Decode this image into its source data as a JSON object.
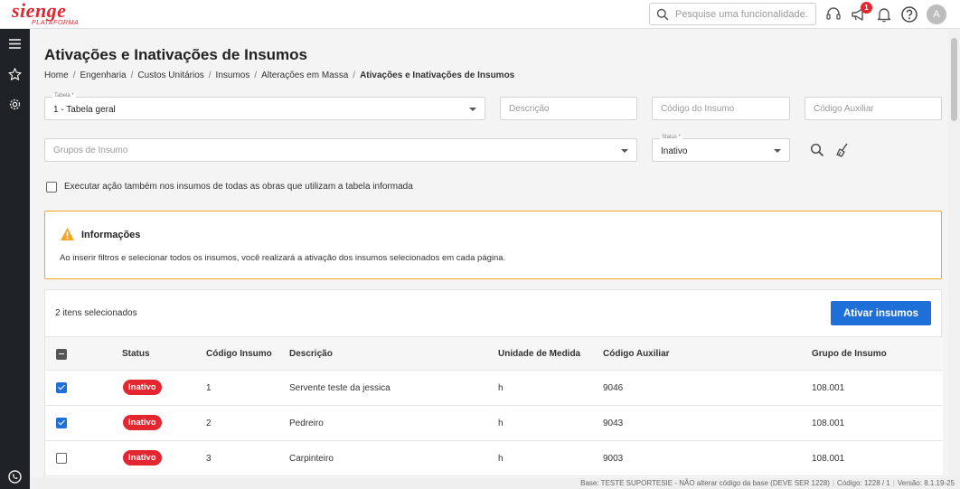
{
  "brand": {
    "name": "sienge",
    "sub": "PLATAFORMA",
    "color": "#e3262f"
  },
  "topbar": {
    "search_placeholder": "Pesquise uma funcionalidade.",
    "notifications_count": "1",
    "avatar_letter": "A",
    "icons": [
      "headset-icon",
      "megaphone-icon",
      "bell-icon",
      "help-icon"
    ]
  },
  "leftnav": {
    "icons": [
      "menu-icon",
      "star-icon",
      "settings-icon",
      "whatsapp-icon"
    ]
  },
  "page": {
    "title": "Ativações e Inativações de Insumos",
    "breadcrumb": [
      "Home",
      "Engenharia",
      "Custos Unitários",
      "Insumos",
      "Alterações em Massa",
      "Ativações e Inativações de Insumos"
    ]
  },
  "filters": {
    "tabela_label": "Tabela *",
    "tabela_value": "1 - Tabela geral",
    "descricao_placeholder": "Descrição",
    "codigo_insumo_placeholder": "Código do Insumo",
    "codigo_auxiliar_placeholder": "Código Auxiliar",
    "grupos_placeholder": "Grupos de Insumo",
    "status_label": "Status *",
    "status_value": "Inativo"
  },
  "option_label": "Executar ação também nos insumos de todas as obras que utilizam a tabela informada",
  "info": {
    "title": "Informações",
    "text": "Ao inserir filtros e selecionar todos os insumos, você realizará a ativação dos insumos selecionados em cada página."
  },
  "table": {
    "selected_count": "2 itens selecionados",
    "action_label": "Ativar insumos",
    "accent": "#1f6fd8",
    "status_color": "#e3262f",
    "headers": {
      "status": "Status",
      "codigo": "Código Insumo",
      "descricao": "Descrição",
      "unidade": "Unidade de Medida",
      "auxiliar": "Código Auxiliar",
      "grupo": "Grupo de Insumo"
    },
    "rows": [
      {
        "checked": true,
        "status": "Inativo",
        "codigo": "1",
        "descricao": "Servente teste da jessica",
        "unidade": "h",
        "auxiliar": "9046",
        "grupo": "108.001"
      },
      {
        "checked": true,
        "status": "Inativo",
        "codigo": "2",
        "descricao": "Pedreiro",
        "unidade": "h",
        "auxiliar": "9043",
        "grupo": "108.001"
      },
      {
        "checked": false,
        "status": "Inativo",
        "codigo": "3",
        "descricao": "Carpinteiro",
        "unidade": "h",
        "auxiliar": "9003",
        "grupo": "108.001"
      }
    ]
  },
  "footer": {
    "base": "Base: TESTE SUPORTESIE - NÃO alterar código da base (DEVE SER 1228)",
    "codigo": "Código: 1228 / 1",
    "versao": "Versão: 8.1.19-25"
  }
}
